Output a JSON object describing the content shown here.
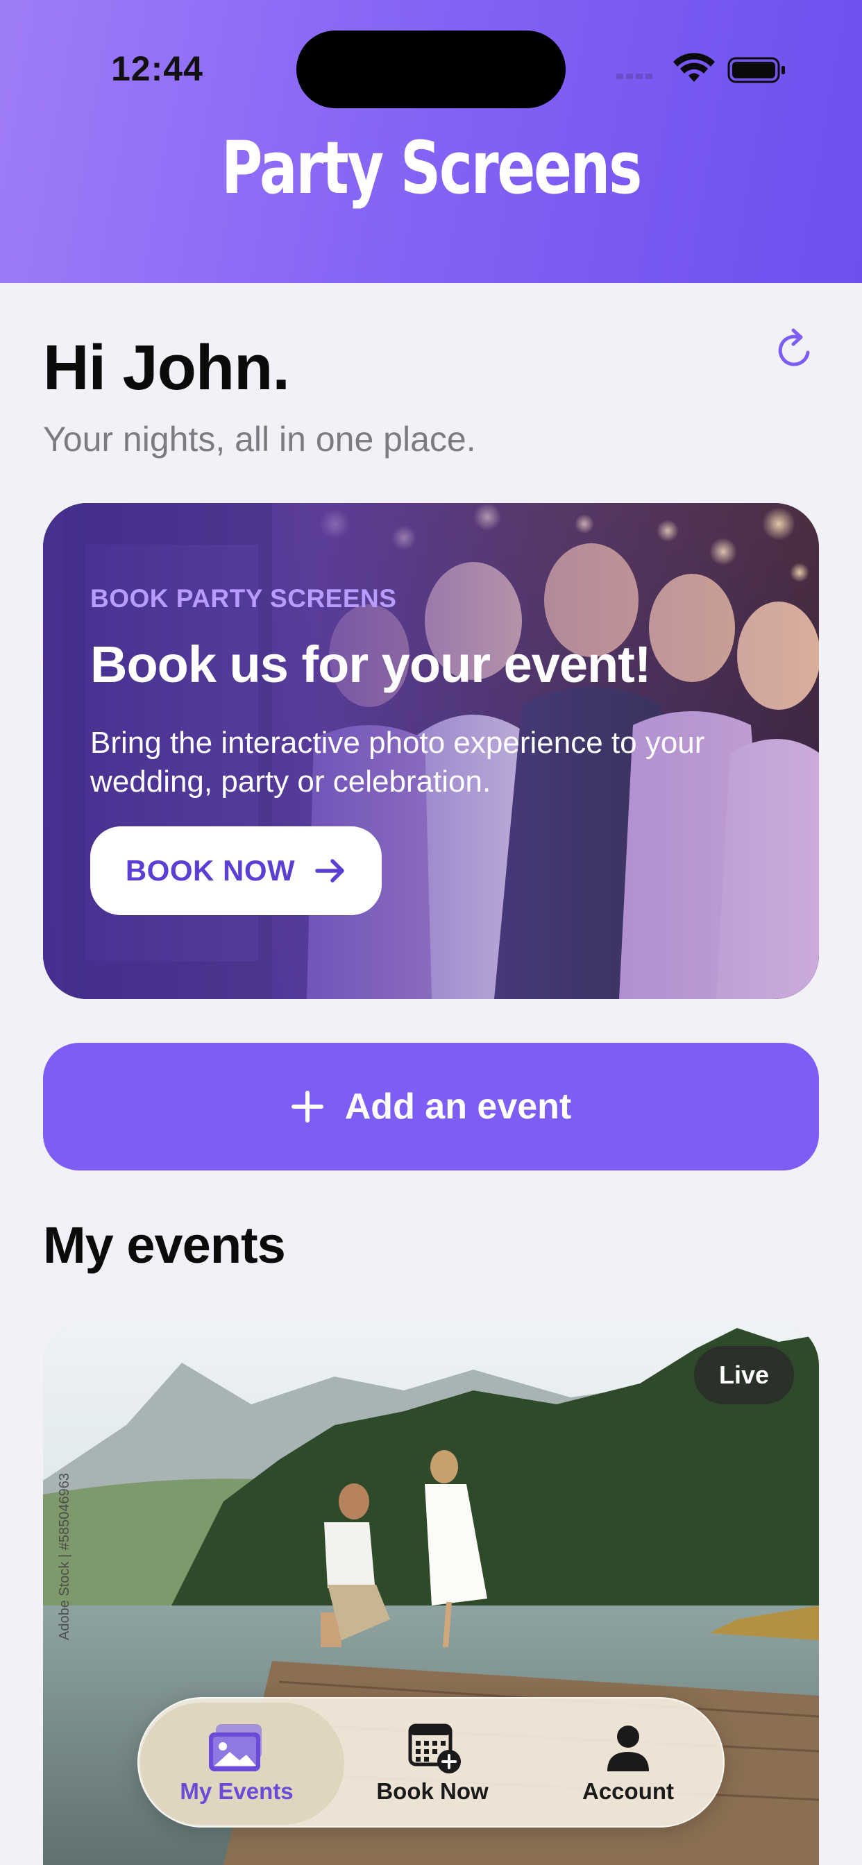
{
  "status_bar": {
    "time": "12:44",
    "icons": [
      "signal-icon",
      "wifi-icon",
      "battery-icon"
    ]
  },
  "header": {
    "app_title": "Party Screens",
    "gradient": [
      "#9f7cf7",
      "#6e4ff0"
    ]
  },
  "greeting": {
    "title": "Hi John.",
    "subtitle": "Your nights, all in one place.",
    "refresh_icon": "refresh-icon"
  },
  "promo": {
    "eyebrow": "BOOK PARTY SCREENS",
    "title": "Book us for your event!",
    "description": "Bring the interactive photo experience to your wedding, party or celebration.",
    "button_label": "BOOK NOW",
    "button_icon": "arrow-right-icon"
  },
  "add_event": {
    "label": "Add an event",
    "icon": "plus-icon",
    "color": "#7d5df3"
  },
  "events": {
    "section_title": "My events",
    "items": [
      {
        "status": "Live",
        "watermark": "Adobe Stock | #585046963"
      }
    ]
  },
  "tab_bar": {
    "tabs": [
      {
        "label": "My Events",
        "icon": "photos-icon",
        "active": true
      },
      {
        "label": "Book Now",
        "icon": "calendar-add-icon",
        "active": false
      },
      {
        "label": "Account",
        "icon": "person-icon",
        "active": false
      }
    ],
    "accent": "#6a4bd8"
  }
}
